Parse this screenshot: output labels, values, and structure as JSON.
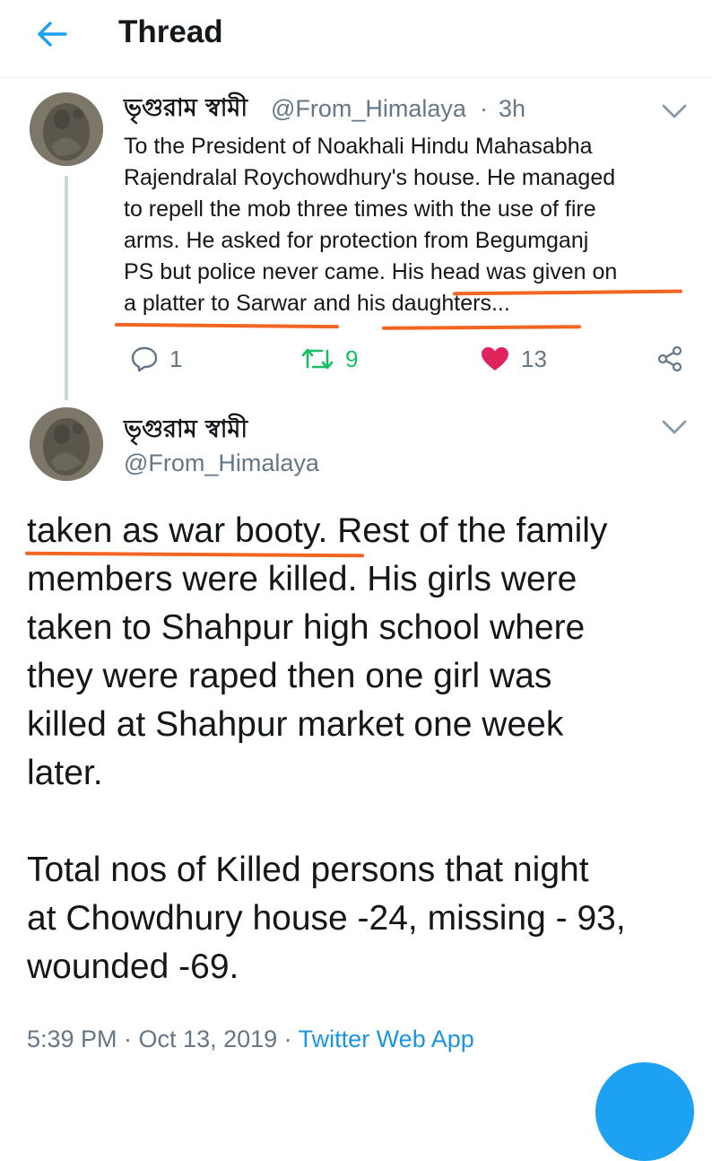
{
  "header": {
    "title": "Thread",
    "back_icon": "arrow-left-icon",
    "accent_color": "#1da1f2"
  },
  "parent_tweet": {
    "display_name": "ভৃগুরাম স্বামী",
    "handle": "@From_Himalaya",
    "separator": "·",
    "time": "3h",
    "text_lines": [
      "To the President of Noakhali Hindu Mahasabha",
      "Rajendralal Roychowdhury's house. He managed",
      "to repell the mob three times with the use of fire",
      "arms. He asked for protection from Begumganj",
      "PS but police never came. His head was given on",
      "a platter to Sarwar and his daughters..."
    ],
    "actions": {
      "reply_count": "1",
      "retweet_count": "9",
      "like_count": "13",
      "retweet_color": "#17bf63",
      "like_color": "#e0245e"
    }
  },
  "main_tweet": {
    "display_name": "ভৃগুরাম স্বামী",
    "handle": "@From_Himalaya",
    "paragraphs": [
      [
        "taken as war booty. Rest of the family",
        "members were killed. His girls were",
        "taken to Shahpur high school where",
        "they were raped then one girl was",
        "killed at Shahpur market one week",
        "later."
      ],
      [
        "Total nos of Killed persons that night",
        "at Chowdhury house -24, missing - 93,",
        "wounded -69."
      ]
    ],
    "timestamp": "5:39 PM · Oct 13, 2019 ·",
    "source": "Twitter Web App"
  },
  "annotation_color": "#f26522"
}
